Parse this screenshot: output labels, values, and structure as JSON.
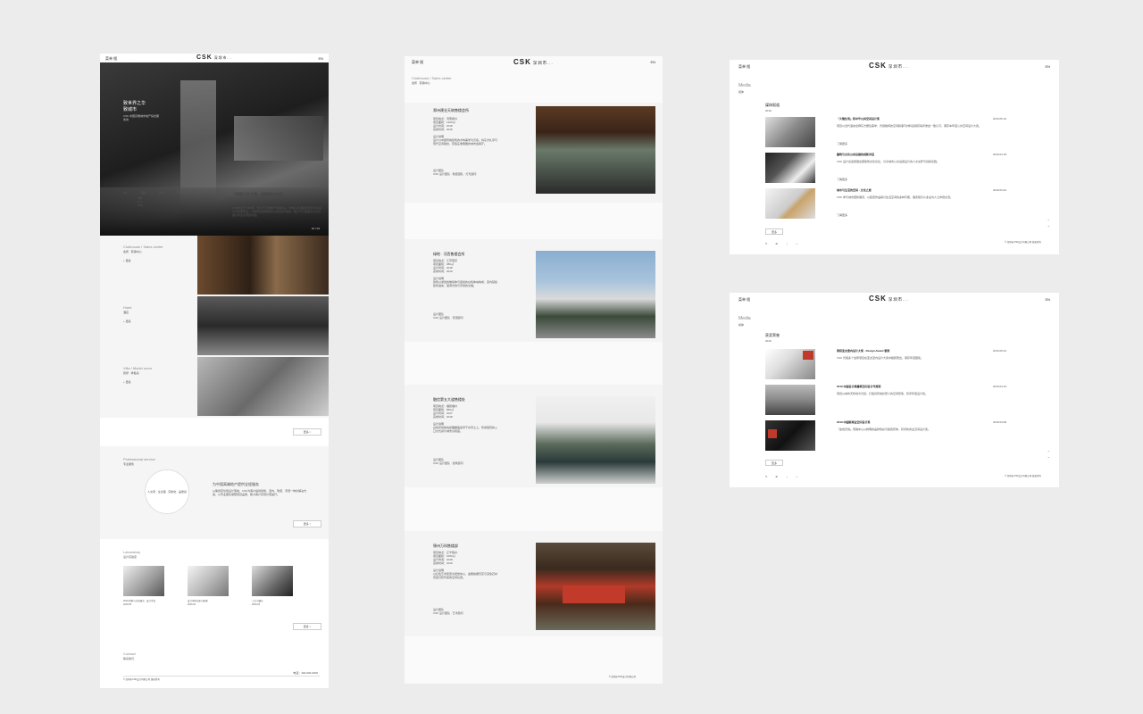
{
  "boards": {
    "home": {
      "logo": "CSK",
      "logo_sub": "深圳市...",
      "nav_left": "菜单 搜",
      "nav_right": "EN",
      "hero_title_1": "致世界之华",
      "hero_title_2": "致城市",
      "hero_text": "CSK 中国高端城市地产综合服务商",
      "hero_pager": "01 / 04",
      "tabs": [
        "简介",
        "理念",
        "团队",
        "荣誉",
        "联系"
      ],
      "tab_lines": [
        "5年",
        "20+",
        "200+"
      ],
      "quote": "「缔造人文之美，创新城市未来」",
      "about_text": "CSK成立于2009年，专注于高端地产营销中心、样板房及酒店会所的空间设计与软装陈设，以国际化视野服务众多知名开发商，致力于打造兼具人文内涵与商业价值的作品。",
      "cats": [
        {
          "en": "Clubhouse / Sales center",
          "cn": "会所 · 营销中心",
          "more": "+ 更多"
        },
        {
          "en": "Hotel",
          "cn": "酒店",
          "more": "+ 更多"
        },
        {
          "en": "Villa / Model room",
          "cn": "别墅 · 样板房",
          "more": "+ 更多"
        }
      ],
      "more_btn": "更多 >",
      "pro_title_en": "Professional service",
      "pro_title_cn": "专业服务",
      "circle_text": "人文观 · 全过程 · 定制化 · 品质感",
      "pro_heading": "为中国高端地产提供全程服务",
      "pro_text": "从策划定位到设计落地，CSK为客户提供建筑、室内、软装、景观一体化解决方案，以专业团队保障项目品质，助力客户实现价值提升。",
      "lab_title_en": "Laboratory",
      "lab_title_cn": "设计实验室",
      "labs": [
        {
          "text": "2019 材料与空间研究 · 设计手记",
          "date": "2019.05"
        },
        {
          "text": "设计中的光影与肌理",
          "date": "2019.04"
        },
        {
          "text": "工艺与细节",
          "date": "2019.03"
        }
      ],
      "contact_en": "Contact",
      "contact_cn": "联系我们",
      "phone": "电话：400-000-0000",
      "footer": "© 深圳市CSK设计有限公司 版权所有"
    },
    "list": {
      "logo": "CSK",
      "logo_sub": "深圳市...",
      "nav_left": "菜单 搜",
      "nav_right": "EN",
      "title_en": "Clubhouse / Sales center",
      "title_cn": "会所 · 营销中心",
      "projects": [
        {
          "name": "郑州建业天筑售楼会所",
          "meta": [
            "项目地点：河南郑州",
            "项目面积：1200㎡",
            "设计时间：2018",
            "完成时间：2019"
          ],
          "desc_label": "设计说明",
          "desc": "设计以中国传统建筑的木构美学为灵感，将东方礼序与现代空间融合，营造庄重典雅的城市会客厅。",
          "team_label": "设计团队",
          "team": "CSK 设计团队 · 软装团队 · 灯光顾问"
        },
        {
          "name": "绿地 · 河西售楼会所",
          "meta": [
            "项目地点：江苏南京",
            "项目面积：980㎡",
            "设计时间：2018",
            "完成时间：2019"
          ],
          "desc_label": "设计说明",
          "desc": "建筑以通透的玻璃体与层叠的白色体块构成，室内延续建筑语言，强调光线与景观的交融。",
          "team_label": "设计团队",
          "team": "CSK 设计团队 · 景观顾问"
        },
        {
          "name": "融信第五大道售楼处",
          "meta": [
            "项目地点：福建福州",
            "项目面积：860㎡",
            "设计时间：2017",
            "完成时间：2018"
          ],
          "desc_label": "设计说明",
          "desc": "白色折线体块如雕塑般悬浮于水景之上，形成强烈的入口仪式感与城市识别度。",
          "team_label": "设计团队",
          "team": "CSK 设计团队 · 建筑顾问"
        },
        {
          "name": "锦州万科售楼部",
          "meta": [
            "项目地点：辽宁锦州",
            "项目面积：1050㎡",
            "设计时间：2018",
            "完成时间：2019"
          ],
          "desc_label": "设计说明",
          "desc": "以红色艺术装置为视觉中心，金属格栅天花与深色石材营造沉稳华贵的空间氛围。",
          "team_label": "设计团队",
          "team": "CSK 设计团队 · 艺术顾问"
        }
      ],
      "footer": "© 深圳市CSK设计有限公司"
    },
    "media1": {
      "logo": "CSK",
      "logo_sub": "深圳市...",
      "nav_left": "菜单 搜",
      "nav_right": "EN",
      "title_en": "Media",
      "title_cn": "媒体",
      "section": "媒体报道",
      "section_sub": "2019",
      "items": [
        {
          "title": "「大隐住宅」获中华公共空间设计奖",
          "date": "2019.05.10",
          "text": "项目以当代语言诠释东方居住美学，凭借独特的空间叙事与材料运用获得评委会一致认可，荣获本年度公共空间设计大奖。",
          "more": "了解更多"
        },
        {
          "title": "建筑与文化公共设施的创新对话",
          "date": "2019.04.18",
          "text": "CSK 设计总监受邀出席建筑文化论坛，分享城市公共设施设计的人文关怀与创新实践。",
          "more": "了解更多"
        },
        {
          "title": "城市与生活的空间 · 文化之旅",
          "date": "2019.03.22",
          "text": "CSK 参与城市更新展览，以装置作品探讨生活空间的多种可能，展览吸引众多业内人士参观交流。",
          "more": "了解更多"
        }
      ],
      "pager": "更多",
      "footer": "© 深圳市CSK设计有限公司 版权所有"
    },
    "media2": {
      "logo": "CSK",
      "logo_sub": "深圳市...",
      "nav_left": "菜单 搜",
      "nav_right": "EN",
      "title_en": "Media",
      "title_cn": "媒体",
      "section": "获奖荣誉",
      "section_sub": "2019",
      "items": [
        {
          "title": "荣获亚太室内设计大奖 · Design Award 银奖",
          "date": "2019.05.22",
          "text": "CSK 凭借多个会所项目在亚太室内设计大奖中脱颖而出，荣获年度银奖。",
          "more": "了解更多"
        },
        {
          "title": "2019 中国设计周建筑空间设计年度奖",
          "date": "2019.04.16",
          "text": "项目以城市天际线为灵感，打造具有地标意义的空间形象，获评年度设计奖。",
          "more": "了解更多"
        },
        {
          "title": "2019 中国新商业空间设计奖",
          "date": "2019.03.08",
          "text": "「金地天悦」营销中心以鲜明的品牌色彩与极简形体，获评新商业空间设计奖。",
          "more": "了解更多"
        }
      ],
      "pager": "更多",
      "footer": "© 深圳市CSK设计有限公司 版权所有"
    }
  }
}
